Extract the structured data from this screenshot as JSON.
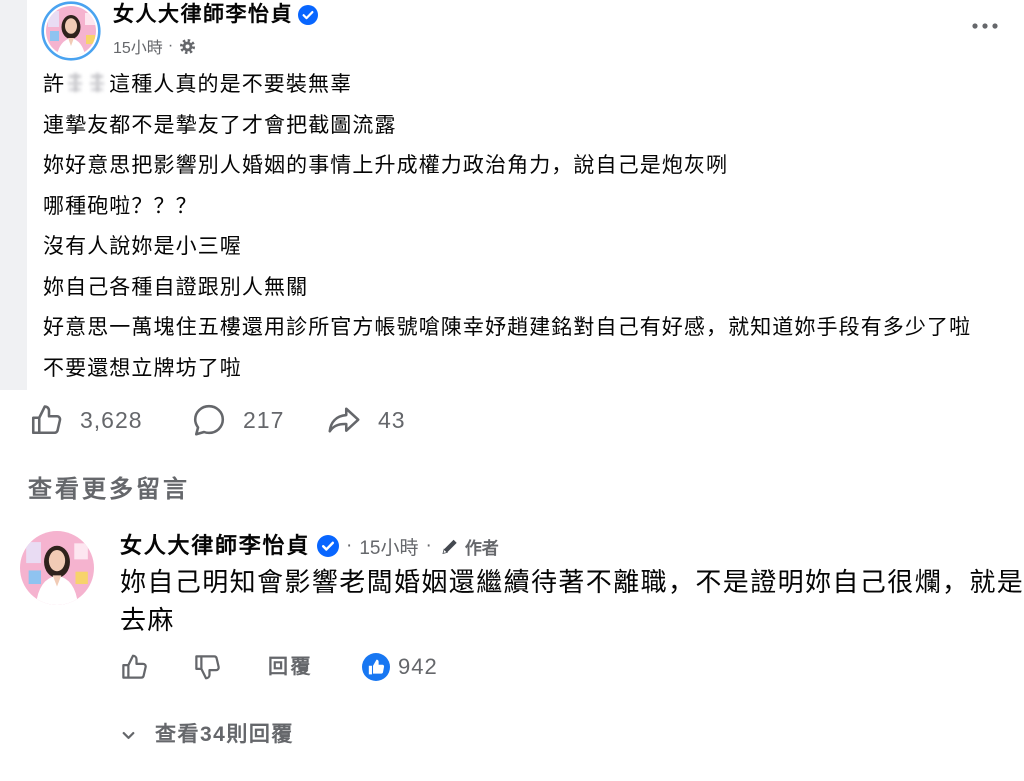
{
  "post": {
    "author": "女人大律師李怡貞",
    "time": "15小時",
    "dot": "·",
    "first_line": {
      "prefix": "許",
      "suffix": "這種人真的是不要裝無辜"
    },
    "lines": [
      "連摯友都不是摯友了才會把截圖流露",
      "妳好意思把影響別人婚姻的事情上升成權力政治角力，說自己是炮灰咧",
      "哪種砲啦？？？",
      "沒有人說妳是小三喔",
      "妳自己各種自證跟別人無關",
      "好意思一萬塊住五樓還用診所官方帳號嗆陳幸妤趙建銘對自己有好感，就知道妳手段有多少了啦",
      "不要還想立牌坊了啦"
    ]
  },
  "reactions": {
    "likes": "3,628",
    "comments": "217",
    "shares": "43"
  },
  "view_more_comments": "查看更多留言",
  "comment": {
    "author": "女人大律師李怡貞",
    "dot": "·",
    "time": "15小時",
    "author_tag": "作者",
    "lines": [
      "妳自己明知會影響老闆婚姻還繼續待著不離職，不是證明妳自己很爛，就是",
      "去麻"
    ],
    "reply_label": "回覆",
    "like_count": "942",
    "view_replies": "查看34則回覆"
  },
  "icons": {
    "verified": "verified-badge-icon",
    "privacy": "gear-icon",
    "more": "more-options-icon",
    "like": "thumbs-up-icon",
    "comment": "comment-bubble-icon",
    "share": "share-arrow-icon",
    "dislike": "thumbs-down-icon",
    "like_reaction": "like-reaction-icon",
    "author": "pencil-icon",
    "expand": "chevron-down-icon"
  },
  "colors": {
    "text": "#050505",
    "secondary": "#65676b",
    "verified": "#0866ff",
    "like_blue": "#1877f2",
    "story_ring": "#4aa3f0"
  }
}
